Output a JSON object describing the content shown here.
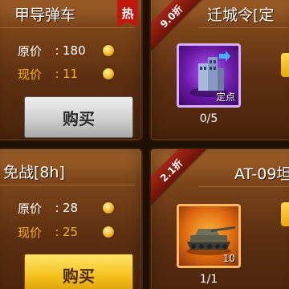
{
  "cards": [
    {
      "title": "甲导弹车",
      "badge": "热",
      "price_original_label": "原价",
      "price_original": "180",
      "price_current_label": "现价",
      "price_current": "11",
      "colon": ":",
      "buy_label": "购买",
      "buy_style": "gray"
    },
    {
      "title": "迁城令[定",
      "discount": "9.0折",
      "item_label": "定点",
      "stock": "0/5"
    },
    {
      "title": "免战[8h]",
      "price_original_label": "原价",
      "price_original": "28",
      "price_current_label": "现价",
      "price_current": "25",
      "colon": ":",
      "buy_label": "购买",
      "buy_style": "gold"
    },
    {
      "title": "AT-09坦",
      "discount": "2.1折",
      "item_count": "10",
      "stock": "1/1"
    }
  ],
  "colors": {
    "current_price": "#f7b219",
    "badge_red": "#c0180f",
    "gold_button": "#f5c21c"
  }
}
